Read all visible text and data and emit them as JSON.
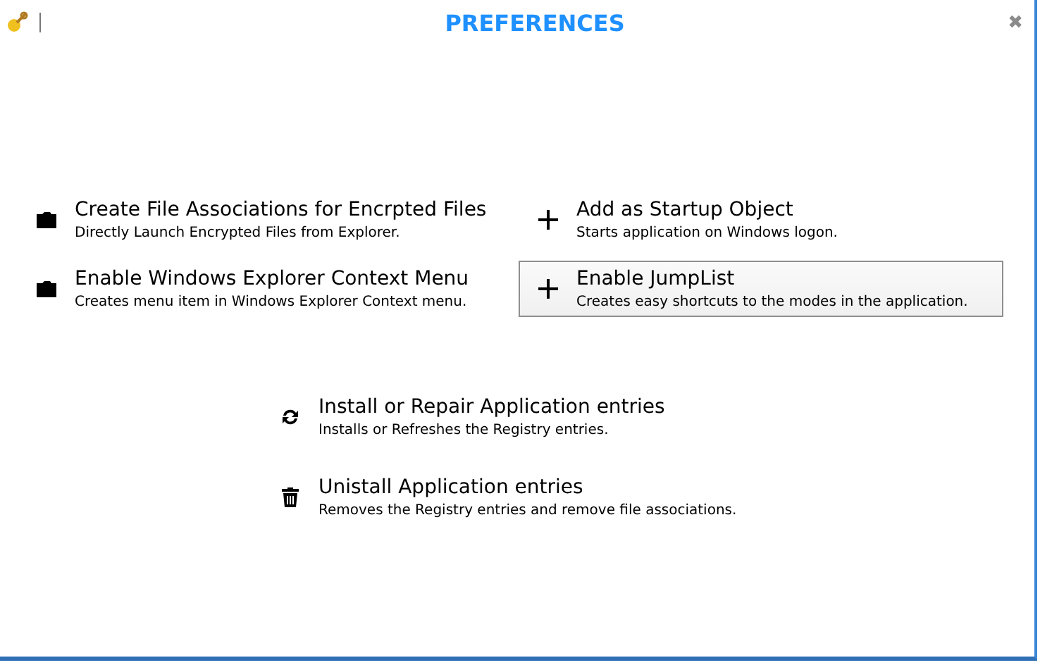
{
  "window": {
    "title": "PREFERENCES",
    "close": "✖"
  },
  "options": [
    {
      "kind": "folder",
      "title": "Create File Associations for Encrpted Files",
      "description": "Directly Launch Encrypted Files from Explorer.",
      "selected": false
    },
    {
      "kind": "plus",
      "title": "Add as Startup Object",
      "description": "Starts application on Windows logon.",
      "selected": false
    },
    {
      "kind": "folder",
      "title": "Enable Windows Explorer Context Menu",
      "description": "Creates menu item in Windows Explorer Context menu.",
      "selected": false
    },
    {
      "kind": "plus",
      "title": "Enable JumpList",
      "description": "Creates easy shortcuts to the modes in the application.",
      "selected": true
    }
  ],
  "registry": [
    {
      "kind": "refresh",
      "title": "Install or Repair Application entries",
      "description": "Installs or Refreshes the Registry entries.",
      "selected": false
    },
    {
      "kind": "trash",
      "title": "Unistall Application entries",
      "description": "Removes the Registry entries and remove file associations.",
      "selected": false
    }
  ]
}
